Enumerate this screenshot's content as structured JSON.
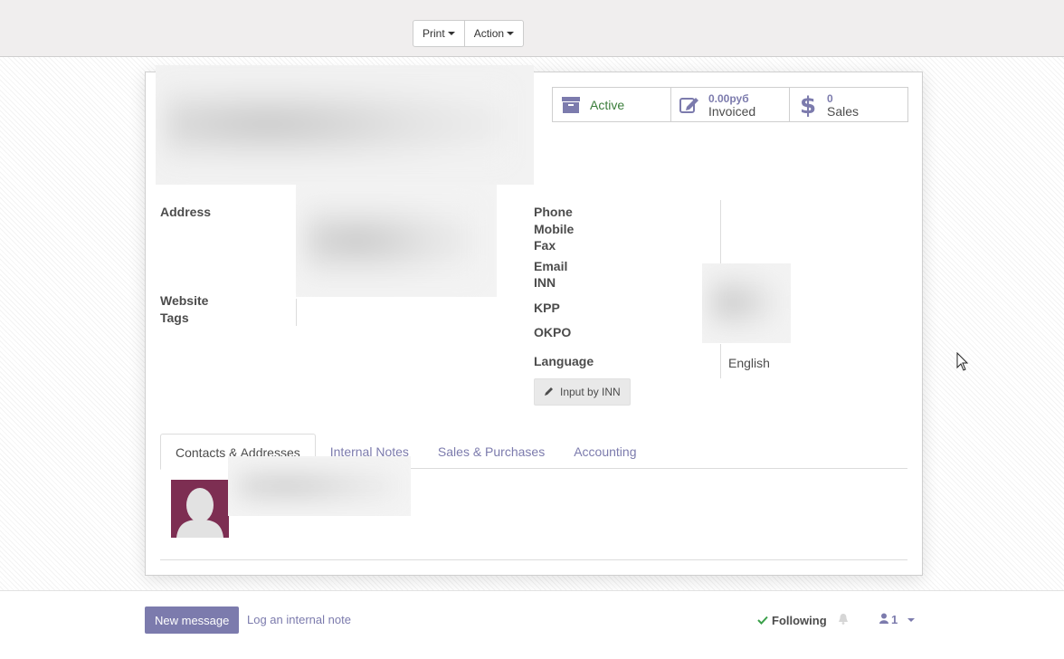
{
  "toolbar": {
    "print_label": "Print",
    "action_label": "Action"
  },
  "stats": {
    "active_label": "Active",
    "invoiced_value": "0.00руб",
    "invoiced_label": "Invoiced",
    "sales_value": "0",
    "sales_label": "Sales"
  },
  "fields": {
    "address_label": "Address",
    "website_label": "Website",
    "tags_label": "Tags",
    "phone_label": "Phone",
    "mobile_label": "Mobile",
    "fax_label": "Fax",
    "email_label": "Email",
    "inn_label": "INN",
    "kpp_label": "KPP",
    "okpo_label": "OKPO",
    "language_label": "Language",
    "language_value": "English"
  },
  "inn_button_label": "Input by INN",
  "tabs": [
    {
      "label": "Contacts & Addresses"
    },
    {
      "label": "Internal Notes"
    },
    {
      "label": "Sales & Purchases"
    },
    {
      "label": "Accounting"
    }
  ],
  "chatter": {
    "new_message_label": "New message",
    "log_note_label": "Log an internal note",
    "following_label": "Following",
    "followers_count": "1"
  },
  "colors": {
    "brand": "#7c7bad",
    "avatar_bg": "#7d2e52",
    "active_green": "#3a7d3a"
  }
}
